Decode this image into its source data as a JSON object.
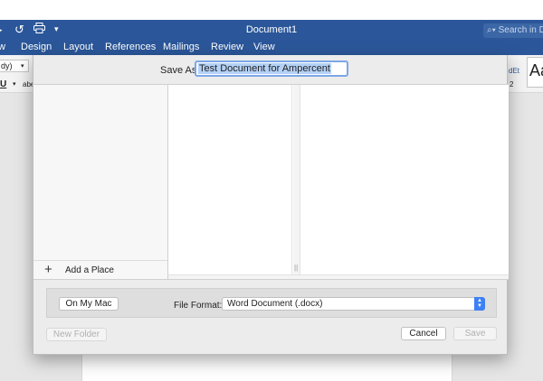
{
  "titlebar": {
    "doc_title": "Document1",
    "search_placeholder": "Search in Do"
  },
  "ribbon_tabs": [
    "w",
    "Design",
    "Layout",
    "References",
    "Mailings",
    "Review",
    "View"
  ],
  "ribbon": {
    "font_name": "dy)",
    "underline_label": "U",
    "strike_label": "abe",
    "style_preview": "Aa",
    "style_fragment": "dEt"
  },
  "dialog": {
    "save_as_label": "Save As:",
    "file_name": "Test Document for Ampercent",
    "add_place_label": "Add a Place",
    "on_my_mac_label": "On My Mac",
    "file_format_label": "File Format:",
    "file_format_value": "Word Document (.docx)",
    "new_folder_label": "New Folder",
    "cancel_label": "Cancel",
    "save_label": "Save"
  },
  "colors": {
    "title_bar": "#2b579a",
    "accent": "#3d80f5",
    "selection": "#b3d1f6"
  }
}
